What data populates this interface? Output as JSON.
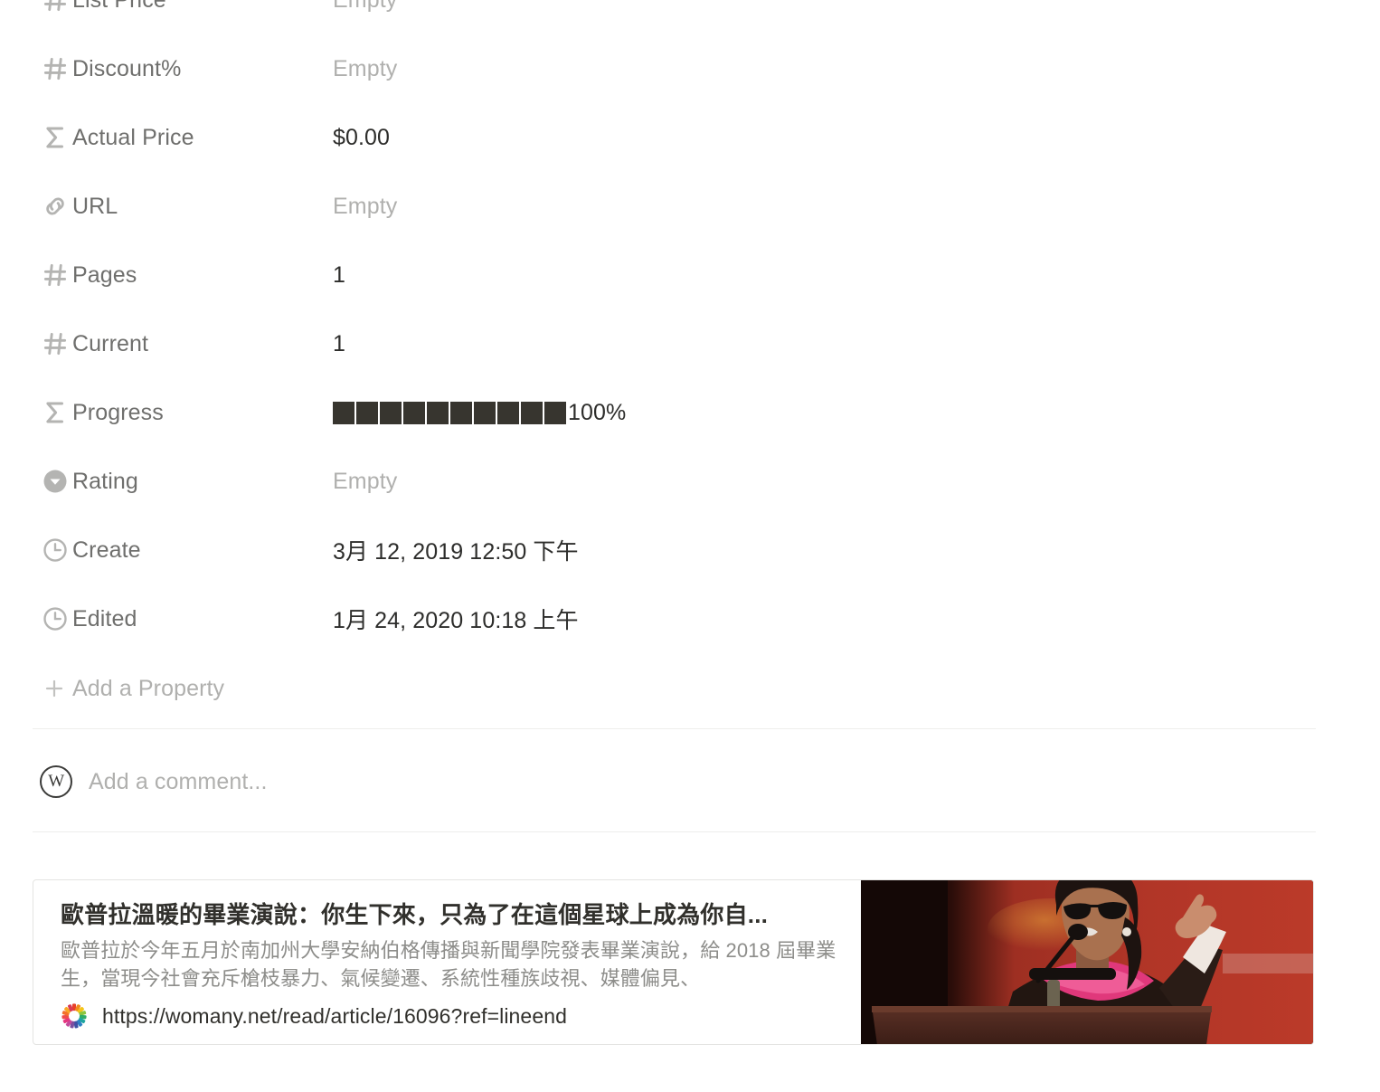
{
  "properties": [
    {
      "icon": "number-icon",
      "label": "List Price",
      "value": "Empty",
      "empty": true,
      "partial": true
    },
    {
      "icon": "number-icon",
      "label": "Discount%",
      "value": "Empty",
      "empty": true
    },
    {
      "icon": "formula-icon",
      "label": "Actual Price",
      "value": "$0.00",
      "empty": false
    },
    {
      "icon": "link-icon",
      "label": "URL",
      "value": "Empty",
      "empty": true
    },
    {
      "icon": "number-icon",
      "label": "Pages",
      "value": "1",
      "empty": false
    },
    {
      "icon": "number-icon",
      "label": "Current",
      "value": "1",
      "empty": false
    },
    {
      "icon": "formula-icon",
      "label": "Progress",
      "value": "",
      "empty": false,
      "progress": {
        "blocks": 10,
        "filled": 10,
        "percent_label": "100%"
      }
    },
    {
      "icon": "select-icon",
      "label": "Rating",
      "value": "Empty",
      "empty": true
    },
    {
      "icon": "clock-icon",
      "label": "Create",
      "value": "3月 12, 2019 12:50 下午",
      "empty": false
    },
    {
      "icon": "clock-icon",
      "label": "Edited",
      "value": "1月 24, 2020 10:18 上午",
      "empty": false
    }
  ],
  "add_property": {
    "label": "Add a Property",
    "icon": "plus-icon"
  },
  "comment": {
    "avatar_initial": "W",
    "placeholder": "Add a comment..."
  },
  "bookmark": {
    "title": "歐普拉溫暖的畢業演說：你生下來，只為了在這個星球上成為你自...",
    "description": "歐普拉於今年五月於南加州大學安納伯格傳播與新聞學院發表畢業演說，給 2018 屆畢業生，當現今社會充斥槍枝暴力、氣候變遷、系統性種族歧視、媒體偏見、",
    "url": "https://womany.net/read/article/16096?ref=lineend",
    "favicon": "womany-rainbow-icon",
    "thumbnail_alt": "speaker-at-podium-photo"
  },
  "colors": {
    "text_primary": "#2d2d2b",
    "text_label": "#6f6f6d",
    "text_placeholder": "#b0b0ae",
    "icon": "#b4b4b2",
    "divider": "#eeeeec",
    "progress_fill": "#37352f",
    "card_border": "#e4e4e2"
  }
}
